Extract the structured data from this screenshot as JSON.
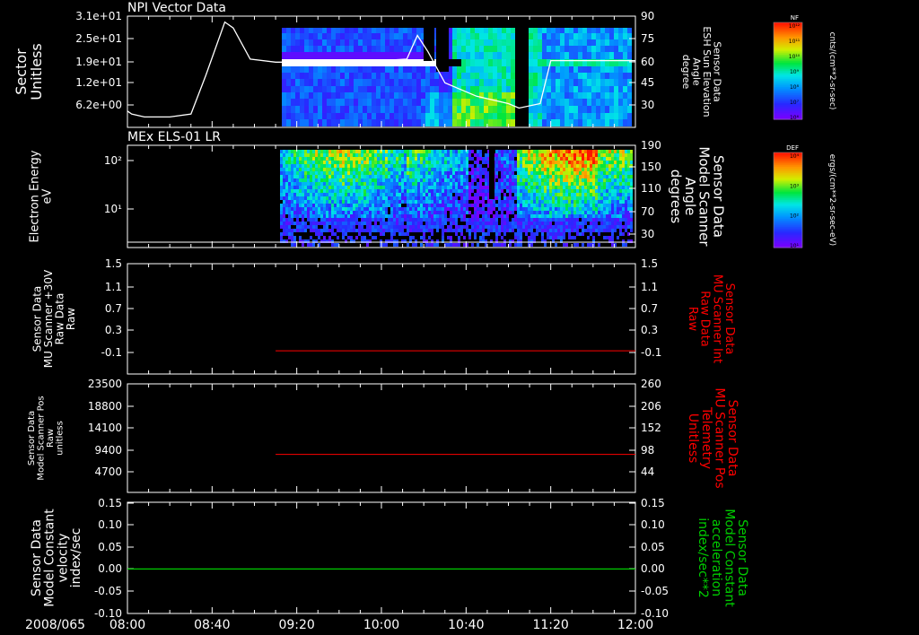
{
  "date_label": "2008/065",
  "x_ticks": [
    "08:00",
    "08:40",
    "09:20",
    "10:00",
    "10:40",
    "11:20",
    "12:00"
  ],
  "colors": {
    "background": "#000000",
    "axis": "#ffffff",
    "red_series": "#ff0000",
    "green_series": "#00cc00"
  },
  "chart_data": [
    {
      "type": "heatmap",
      "title": "NPI Vector Data",
      "ylabel_left": [
        "Sector",
        "Unitless"
      ],
      "ylabel_right": [
        "Sensor Data",
        "ESH Sun Elevation",
        "Angle",
        "degree"
      ],
      "y_left_ticks": [
        "3.1e+01",
        "2.5e+01",
        "1.9e+01",
        "1.2e+01",
        "6.2e+00"
      ],
      "y_right_ticks": [
        "90",
        "75",
        "60",
        "45",
        "30"
      ],
      "ylim_left": [
        0,
        31
      ],
      "ylim_right": [
        15,
        90
      ],
      "colorbar": {
        "label": "NF",
        "units": "cnts/(cm**2-sr-sec)",
        "ticks": [
          "10¹²",
          "10¹¹",
          "10¹⁰",
          "10⁹",
          "10⁸",
          "10⁷",
          "10⁶"
        ]
      },
      "overlay_line": {
        "units": "degree",
        "x": [
          "08:00",
          "08:02",
          "08:08",
          "08:20",
          "08:30",
          "08:37",
          "08:46",
          "08:50",
          "08:58",
          "09:10",
          "09:40",
          "10:00",
          "10:12",
          "10:17",
          "10:22",
          "10:30",
          "10:45",
          "11:00",
          "11:05",
          "11:15",
          "11:20",
          "12:00"
        ],
        "y": [
          26,
          24,
          22,
          22,
          24,
          50,
          86,
          82,
          61,
          59,
          59,
          60,
          61,
          77,
          66,
          45,
          36,
          31,
          28,
          31,
          60,
          60
        ]
      }
    },
    {
      "type": "heatmap",
      "title": "MEx ELS-01 LR",
      "ylabel_left": [
        "Electron Energy",
        "eV"
      ],
      "ylabel_right": [
        "Sensor Data",
        "Model Scanner",
        "Angle",
        "degrees"
      ],
      "y_left_ticks": [
        "10²",
        "10¹"
      ],
      "y_right_ticks": [
        "190",
        "150",
        "110",
        "70",
        "30"
      ],
      "yscale_left": "log",
      "ylim_right": [
        0,
        190
      ],
      "colorbar": {
        "label": "DEF",
        "units": "ergs/(cm**2-sr-sec-eV)",
        "ticks": [
          "10⁴",
          "10³",
          "10²",
          "10¹"
        ]
      },
      "overlay_line": {
        "units": "degrees",
        "x": [
          "08:00",
          "12:00"
        ],
        "y": [
          10,
          10
        ]
      }
    },
    {
      "type": "line",
      "ylabel_left": [
        "Sensor Data",
        "MU Scanner +30V",
        "Raw Data",
        "Raw"
      ],
      "ylabel_right": [
        "Sensor Data",
        "MU Scanner Int",
        "Raw Data",
        "Raw"
      ],
      "y_ticks": [
        "1.5",
        "1.1",
        "0.7",
        "0.3",
        "-0.1"
      ],
      "ylim": [
        -0.4,
        1.5
      ],
      "series": [
        {
          "x": [
            "09:10",
            "12:00"
          ],
          "y": [
            -0.0,
            -0.0
          ]
        }
      ]
    },
    {
      "type": "line",
      "ylabel_left": [
        "Sensor Data",
        "Model Scanner Pos",
        "Raw",
        "unitless"
      ],
      "ylabel_right": [
        "Sensor Data",
        "MU Scanner Pos",
        "Telemetry",
        "Unitless"
      ],
      "y_left_ticks": [
        "23500",
        "18800",
        "14100",
        "9400",
        "4700"
      ],
      "y_right_ticks": [
        "260",
        "206",
        "152",
        "98",
        "44"
      ],
      "ylim_left": [
        0,
        23500
      ],
      "ylim_right": [
        0,
        260
      ],
      "series": [
        {
          "x": [
            "09:10",
            "12:00"
          ],
          "y": [
            9400,
            9400
          ]
        }
      ]
    },
    {
      "type": "line",
      "ylabel_left": [
        "Sensor Data",
        "Model Constant",
        "velocity",
        "index/sec"
      ],
      "ylabel_right": [
        "Sensor Data",
        "Model Constant",
        "acceleration",
        "index/sec**2"
      ],
      "y_ticks": [
        "0.15",
        "0.10",
        "0.05",
        "0.00",
        "-0.05",
        "-0.10"
      ],
      "ylim": [
        -0.1,
        0.15
      ],
      "series": [
        {
          "x": [
            "08:00",
            "12:00"
          ],
          "y": [
            0.0,
            0.0
          ]
        }
      ]
    }
  ]
}
